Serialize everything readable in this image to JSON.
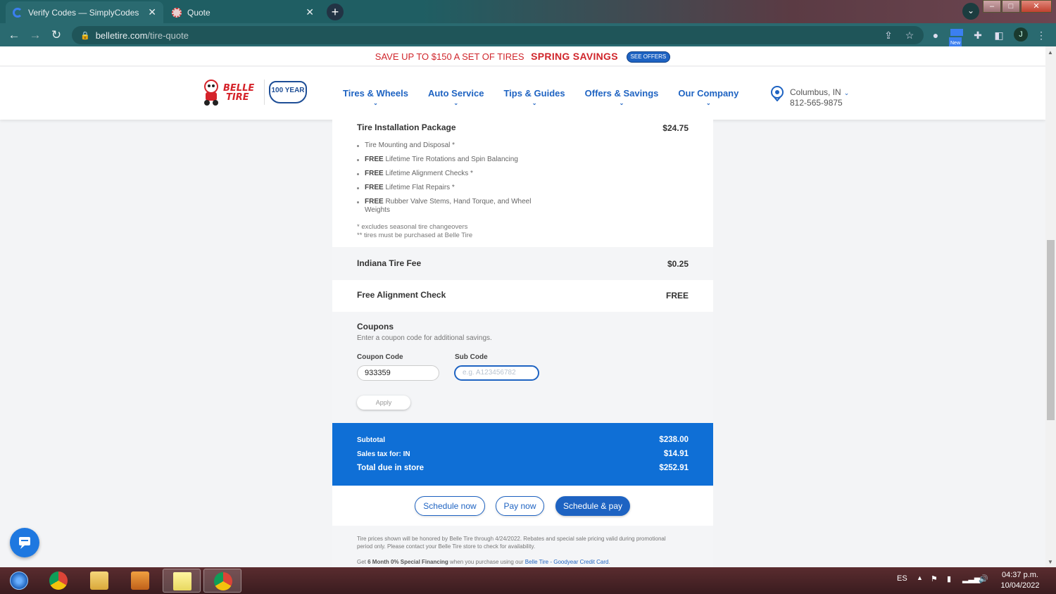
{
  "browser": {
    "tabs": [
      {
        "title": "Verify Codes — SimplyCodes",
        "active": true
      },
      {
        "title": "Quote",
        "active": false
      }
    ],
    "url_host": "belletire.com",
    "url_path": "/tire-quote",
    "profile_initial": "J",
    "new_badge": "New"
  },
  "promo": {
    "text": "SAVE UP TO $150 A SET OF TIRES",
    "highlight": "SPRING SAVINGS",
    "button": "SEE OFFERS"
  },
  "header": {
    "logo_word1": "BELLE",
    "logo_word2": "TIRE",
    "anniversary": "100 YEAR",
    "nav": [
      {
        "label": "Tires & Wheels"
      },
      {
        "label": "Auto Service"
      },
      {
        "label": "Tips & Guides"
      },
      {
        "label": "Offers & Savings"
      },
      {
        "label": "Our Company"
      }
    ],
    "location_city": "Columbus, IN",
    "location_phone": "812-565-9875"
  },
  "quote": {
    "install_title": "Tire Installation Package",
    "install_price": "$24.75",
    "install_items": [
      {
        "bold": "",
        "text": "Tire Mounting and Disposal *"
      },
      {
        "bold": "FREE",
        "text": " Lifetime Tire Rotations and Spin Balancing"
      },
      {
        "bold": "FREE",
        "text": " Lifetime Alignment Checks *"
      },
      {
        "bold": "FREE",
        "text": " Lifetime Flat Repairs *"
      },
      {
        "bold": "FREE",
        "text": " Rubber Valve Stems, Hand Torque, and Wheel Weights"
      }
    ],
    "note1": "* excludes seasonal tire changeovers",
    "note2": "** tires must be purchased at Belle Tire",
    "fee_title": "Indiana Tire Fee",
    "fee_price": "$0.25",
    "align_title": "Free Alignment Check",
    "align_price": "FREE"
  },
  "coupons": {
    "title": "Coupons",
    "subtitle": "Enter a coupon code for additional savings.",
    "code_label": "Coupon Code",
    "code_value": "933359",
    "sub_label": "Sub Code",
    "sub_placeholder": "e.g. A123456782",
    "apply": "Apply"
  },
  "totals": {
    "subtotal_label": "Subtotal",
    "subtotal": "$238.00",
    "tax_label": "Sales tax for: IN",
    "tax": "$14.91",
    "total_label": "Total due in store",
    "total": "$252.91"
  },
  "actions": {
    "schedule_now": "Schedule now",
    "pay_now": "Pay now",
    "schedule_pay": "Schedule & pay"
  },
  "disclaimer": {
    "text": "Tire prices shown will be honored by Belle Tire through 4/24/2022. Rebates and special sale pricing valid during promotional period only. Please contact your Belle Tire store to check for availability.",
    "fin_pre": "Get ",
    "fin_bold": "6 Month 0% Special Financing",
    "fin_mid": " when you purchase using our ",
    "fin_link": "Belle Tire - Goodyear Credit Card",
    "fin_end": "."
  },
  "taskbar": {
    "lang": "ES",
    "time": "04:37 p.m.",
    "date": "10/04/2022"
  },
  "colors": {
    "brand_blue": "#1e63c2",
    "total_blue": "#0f6fd6",
    "promo_red": "#d0262c",
    "chrome_teal": "#2a6a70"
  }
}
